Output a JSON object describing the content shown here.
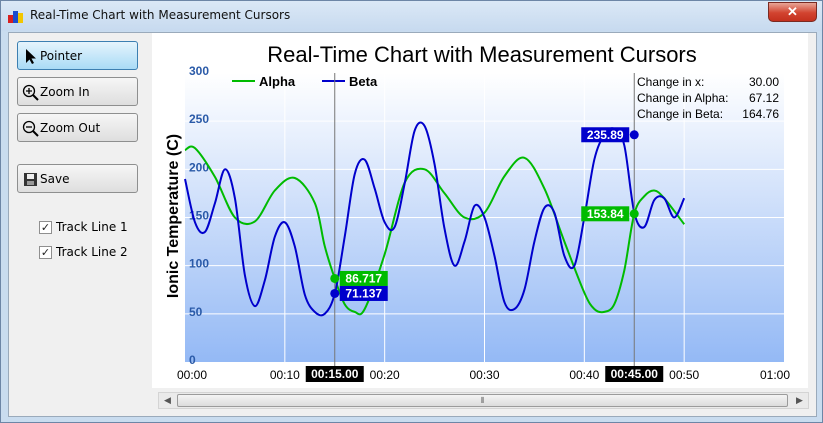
{
  "window": {
    "title": "Real-Time Chart with Measurement Cursors",
    "close_symbol": "✕"
  },
  "toolbar": {
    "pointer": "Pointer",
    "zoom_in": "Zoom In",
    "zoom_out": "Zoom Out",
    "save": "Save"
  },
  "tracks": [
    {
      "label": "Track Line 1",
      "checked": true
    },
    {
      "label": "Track Line 2",
      "checked": true
    }
  ],
  "scrollbar": {
    "thumb_grip": "⦀",
    "left_arrow": "◀",
    "right_arrow": "▶"
  },
  "colors": {
    "alpha": "#00bb00",
    "beta": "#0000cc",
    "plot_top": "#ffffff",
    "plot_bottom": "#94b9f5"
  },
  "chart_data": {
    "type": "line",
    "title": "Real-Time Chart with Measurement Cursors",
    "ylabel": "Ionic Temperature (C)",
    "xlabel": "",
    "ylim": [
      0,
      300
    ],
    "xlim_seconds": [
      0,
      60
    ],
    "y_ticks": [
      "0",
      "50",
      "100",
      "150",
      "200",
      "250",
      "300"
    ],
    "x_ticks": [
      "00:00",
      "00:10",
      "00:20",
      "00:30",
      "00:40",
      "00:50",
      "01:00"
    ],
    "grid": true,
    "legend": "top-left",
    "series": [
      {
        "name": "Alpha",
        "x": [
          0,
          1,
          3,
          5,
          7,
          9,
          11,
          13,
          14,
          15,
          16,
          17,
          18,
          20,
          22,
          24,
          26,
          28,
          30,
          32,
          34,
          36,
          38,
          40,
          41,
          42,
          43,
          44,
          45,
          46,
          47,
          48,
          50
        ],
        "y": [
          220,
          222,
          192,
          150,
          146,
          178,
          191,
          165,
          120,
          86.7,
          60,
          52,
          55,
          112,
          186,
          200,
          175,
          150,
          155,
          193,
          212,
          180,
          125,
          72,
          55,
          52,
          60,
          95,
          153.8,
          172,
          178,
          170,
          143
        ]
      },
      {
        "name": "Beta",
        "x": [
          0,
          1,
          2,
          3,
          4,
          5,
          6,
          7,
          8,
          9,
          10,
          11,
          12,
          13,
          14,
          15,
          16,
          17,
          18,
          19,
          20,
          21,
          22,
          23,
          24,
          25,
          26,
          27,
          28,
          29,
          30,
          31,
          32,
          33,
          34,
          35,
          36,
          37,
          38,
          39,
          40,
          41,
          42,
          43,
          44,
          45,
          46,
          47,
          48,
          49,
          50
        ],
        "y": [
          190,
          145,
          135,
          165,
          200,
          170,
          90,
          58,
          85,
          130,
          145,
          120,
          70,
          52,
          50,
          71.1,
          130,
          195,
          210,
          180,
          145,
          140,
          185,
          240,
          245,
          205,
          138,
          100,
          125,
          162,
          150,
          110,
          62,
          55,
          75,
          125,
          160,
          155,
          110,
          100,
          150,
          210,
          235.9,
          242,
          225,
          155,
          140,
          168,
          170,
          150,
          170
        ]
      }
    ],
    "cursors": [
      {
        "time": "00:15.00",
        "x": 15,
        "alpha": "86.717",
        "beta": "71.137"
      },
      {
        "time": "00:45.00",
        "x": 45,
        "alpha": "153.84",
        "beta": "235.89"
      }
    ],
    "measure": {
      "rows": [
        {
          "label": "Change in x:",
          "value": "30.00"
        },
        {
          "label": "Change in Alpha:",
          "value": "67.12"
        },
        {
          "label": "Change in Beta:",
          "value": "164.76"
        }
      ]
    }
  }
}
